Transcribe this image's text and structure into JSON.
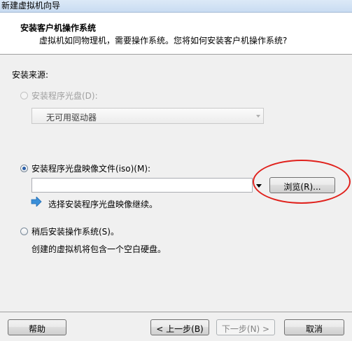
{
  "window": {
    "title": "新建虚拟机向导"
  },
  "header": {
    "title": "安装客户机操作系统",
    "subtitle": "虚拟机如同物理机，需要操作系统。您将如何安装客户机操作系统?"
  },
  "source": {
    "label": "安装来源:",
    "disc": {
      "label": "安装程序光盘(D):",
      "drive_value": "无可用驱动器",
      "checked": false,
      "enabled": false
    },
    "iso": {
      "label": "安装程序光盘映像文件(iso)(M):",
      "path_value": "",
      "checked": true,
      "browse_label": "浏览(R)..."
    },
    "info_text": "选择安装程序光盘映像继续。",
    "later": {
      "label": "稍后安装操作系统(S)。",
      "description": "创建的虚拟机将包含一个空白硬盘。",
      "checked": false
    }
  },
  "footer": {
    "help_label": "帮助",
    "back_label": "< 上一步(B)",
    "next_label": "下一步(N) >",
    "cancel_label": "取消"
  },
  "colors": {
    "annotation_circle": "#e0211c",
    "info_arrow": "#3a8fd9",
    "radio_checked": "#2a5fa8"
  },
  "icons": {
    "info_arrow": "right-arrow-icon",
    "combo_arrow": "chevron-down-icon"
  }
}
